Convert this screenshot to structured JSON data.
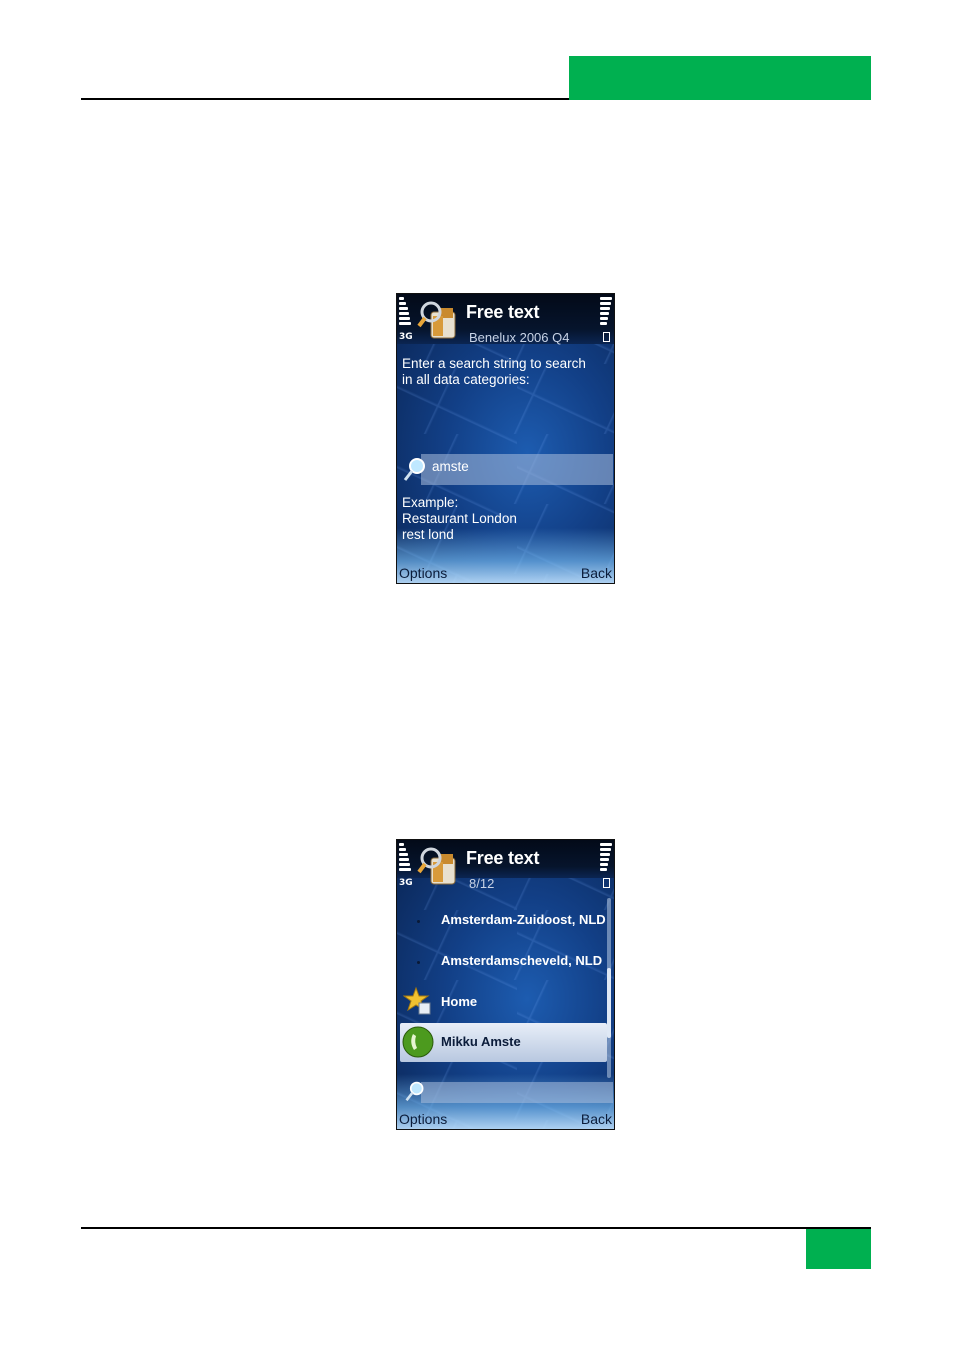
{
  "screen1": {
    "network": "3G",
    "title": "Free text",
    "subtitle": "Benelux 2006 Q4",
    "instruction_line1": "Enter a search string to search",
    "instruction_line2": "in all data categories:",
    "search_value": "amste",
    "example_title": "Example:",
    "example_line1": "Restaurant London",
    "example_line2": "rest lond",
    "softkey_left": "Options",
    "softkey_right": "Back"
  },
  "screen2": {
    "network": "3G",
    "title": "Free text",
    "subtitle": "8/12",
    "results": [
      {
        "label": "Amsterdam-Zuidoost, NLD",
        "icon": "bullet"
      },
      {
        "label": "Amsterdamscheveld, NLD",
        "icon": "bullet"
      },
      {
        "label": "Home",
        "icon": "star-icon"
      },
      {
        "label": "Mikku Amste",
        "icon": "phone-icon",
        "selected": true
      }
    ],
    "search_value": "",
    "softkey_left": "Options",
    "softkey_right": "Back"
  },
  "colors": {
    "accent_green": "#00b050",
    "screen_blue": "#123f86"
  }
}
